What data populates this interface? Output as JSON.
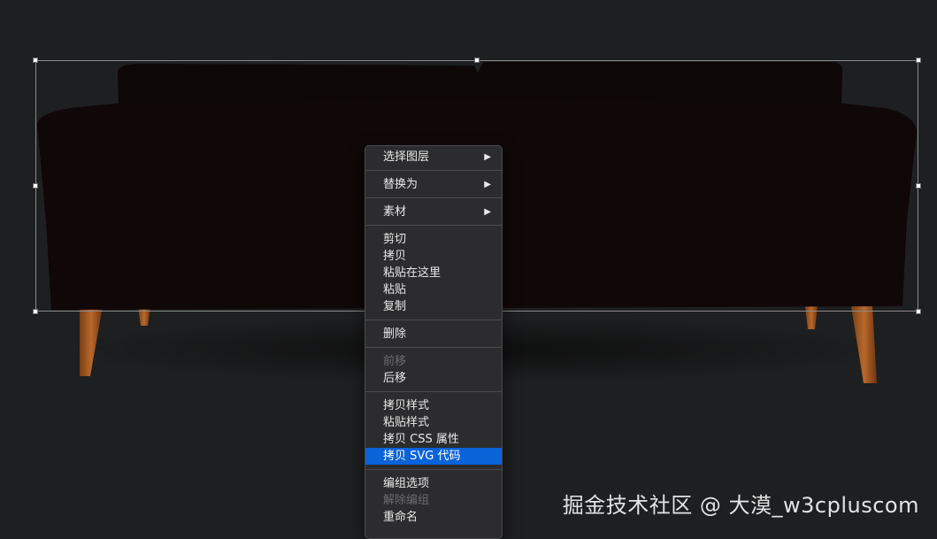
{
  "canvas": {
    "background_color": "#1e1f20",
    "object_name": "sofa-image"
  },
  "context_menu": {
    "groups": [
      [
        {
          "label": "选择图层",
          "submenu": true,
          "enabled": true
        }
      ],
      [
        {
          "label": "替换为",
          "submenu": true,
          "enabled": true
        }
      ],
      [
        {
          "label": "素材",
          "submenu": true,
          "enabled": true
        }
      ],
      [
        {
          "label": "剪切",
          "enabled": true
        },
        {
          "label": "拷贝",
          "enabled": true
        },
        {
          "label": "粘贴在这里",
          "enabled": true
        },
        {
          "label": "粘贴",
          "enabled": true
        },
        {
          "label": "复制",
          "enabled": true
        }
      ],
      [
        {
          "label": "删除",
          "enabled": true
        }
      ],
      [
        {
          "label": "前移",
          "enabled": false
        },
        {
          "label": "后移",
          "enabled": true
        }
      ],
      [
        {
          "label": "拷贝样式",
          "enabled": true
        },
        {
          "label": "粘贴样式",
          "enabled": true
        },
        {
          "label": "拷贝 CSS 属性",
          "enabled": true
        },
        {
          "label": "拷贝 SVG 代码",
          "enabled": true,
          "highlighted": true
        }
      ],
      [
        {
          "label": "编组选项",
          "enabled": true
        },
        {
          "label": "解除编组",
          "enabled": false
        },
        {
          "label": "重命名",
          "enabled": true
        }
      ]
    ],
    "submenu_arrow": "▶",
    "highlight_color": "#0a63d8"
  },
  "watermark": {
    "text": "掘金技术社区 @ 大漠_w3cpluscom"
  }
}
